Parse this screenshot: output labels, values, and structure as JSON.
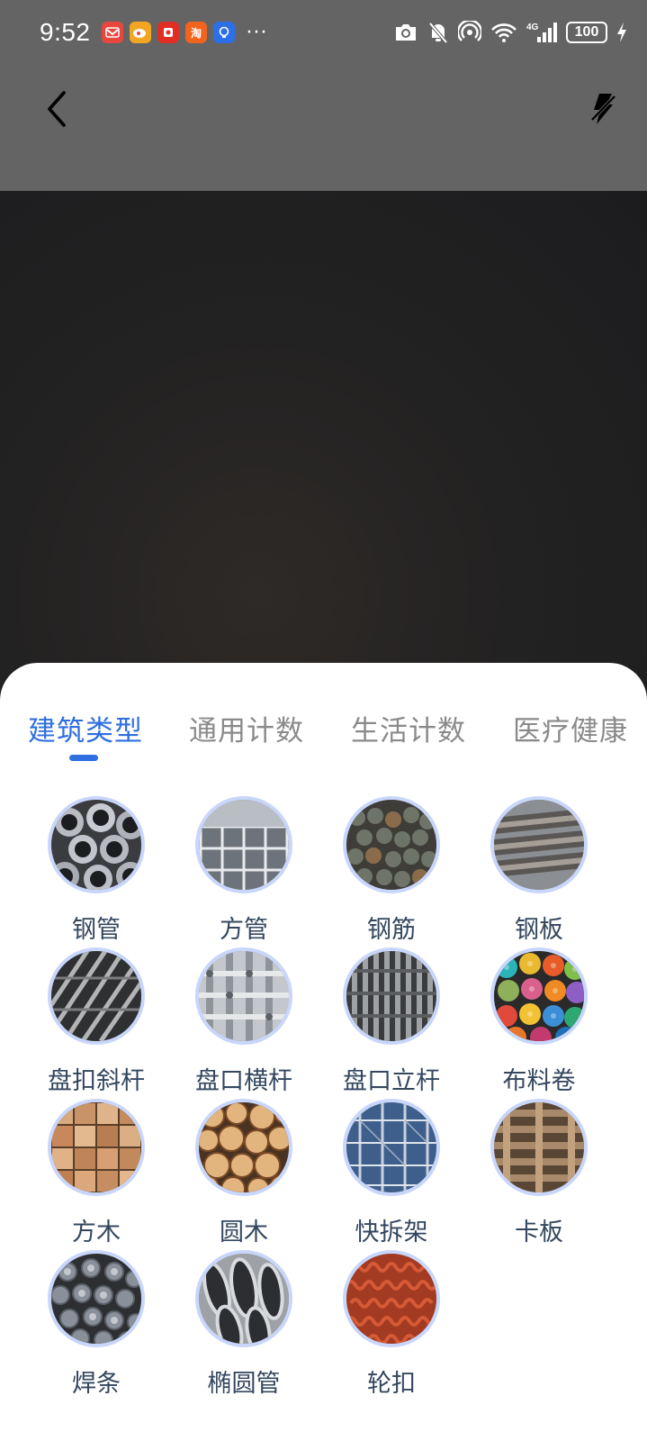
{
  "status_bar": {
    "time": "9:52",
    "notification_icons": [
      {
        "icon": "app-notification-red-icon",
        "color": "#e8473e"
      },
      {
        "icon": "weibo-icon",
        "color": "#f2a623"
      },
      {
        "icon": "pdd-icon",
        "color": "#e02e24"
      },
      {
        "icon": "taobao-icon",
        "color": "#f2641d"
      },
      {
        "icon": "lightbulb-app-icon",
        "color": "#2c6fe6"
      }
    ],
    "more": "···",
    "battery": "100"
  },
  "header": {
    "back_icon": "chevron-left-icon",
    "flash_icon": "flash-off-icon"
  },
  "tabs": [
    {
      "label": "建筑类型",
      "active": true
    },
    {
      "label": "通用计数",
      "active": false
    },
    {
      "label": "生活计数",
      "active": false
    },
    {
      "label": "医疗健康",
      "active": false
    }
  ],
  "items": [
    {
      "label": "钢管",
      "icon": "steel-pipe-thumbnail"
    },
    {
      "label": "方管",
      "icon": "square-tube-thumbnail"
    },
    {
      "label": "钢筋",
      "icon": "rebar-thumbnail"
    },
    {
      "label": "钢板",
      "icon": "steel-plate-thumbnail"
    },
    {
      "label": "盘扣斜杆",
      "icon": "diagonal-rod-thumbnail"
    },
    {
      "label": "盘口横杆",
      "icon": "horizontal-rod-thumbnail"
    },
    {
      "label": "盘口立杆",
      "icon": "vertical-rod-thumbnail"
    },
    {
      "label": "布料卷",
      "icon": "fabric-roll-thumbnail"
    },
    {
      "label": "方木",
      "icon": "square-timber-thumbnail"
    },
    {
      "label": "圆木",
      "icon": "round-log-thumbnail"
    },
    {
      "label": "快拆架",
      "icon": "quick-scaffold-thumbnail"
    },
    {
      "label": "卡板",
      "icon": "pallet-thumbnail"
    },
    {
      "label": "焊条",
      "icon": "welding-rod-thumbnail"
    },
    {
      "label": "椭圆管",
      "icon": "oval-tube-thumbnail"
    },
    {
      "label": "轮扣",
      "icon": "wheel-buckle-thumbnail"
    }
  ],
  "colors": {
    "accent": "#2f6fe0",
    "thumb_ring": "#c9d6fb",
    "label": "#34475f",
    "tab_inactive": "#8a8a8a"
  }
}
